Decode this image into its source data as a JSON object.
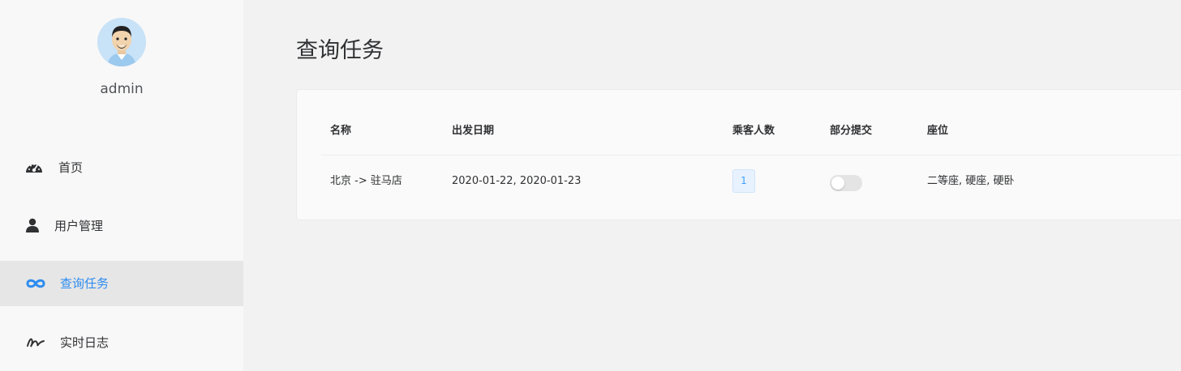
{
  "user": {
    "name": "admin"
  },
  "nav": [
    {
      "label": "首页",
      "icon": "dashboard-icon"
    },
    {
      "label": "用户管理",
      "icon": "user-icon"
    },
    {
      "label": "查询任务",
      "icon": "infinity-icon",
      "active": true
    },
    {
      "label": "实时日志",
      "icon": "signature-icon"
    }
  ],
  "page": {
    "title": "查询任务"
  },
  "table": {
    "headers": [
      "名称",
      "出发日期",
      "乘客人数",
      "部分提交",
      "座位"
    ],
    "rows": [
      {
        "name": "北京 -> 驻马店",
        "dates": "2020-01-22, 2020-01-23",
        "passengers": "1",
        "partial_submit": false,
        "seats": "二等座, 硬座, 硬卧"
      }
    ]
  },
  "colors": {
    "accent": "#2d8cf0",
    "active_bg": "#e6e6e6",
    "badge": "#409eff"
  }
}
